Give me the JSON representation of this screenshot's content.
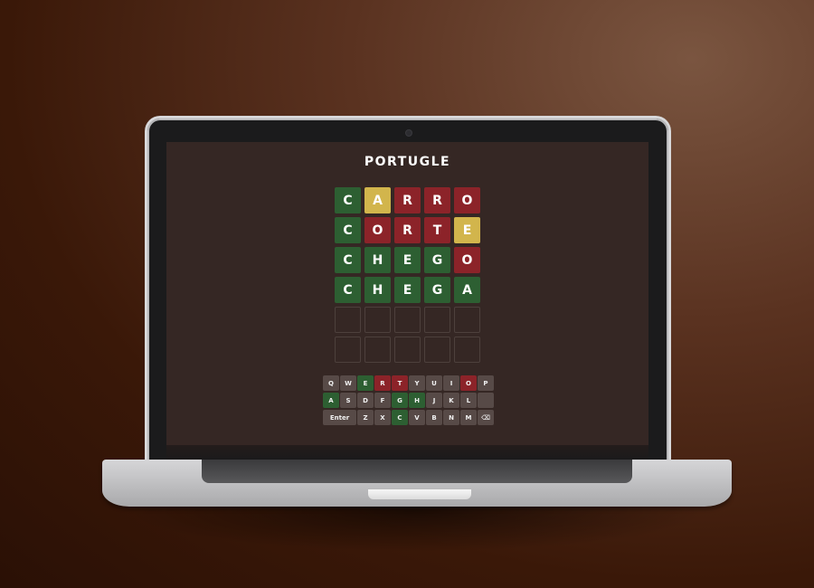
{
  "app": {
    "title": "PORTUGLE"
  },
  "board": {
    "rows": [
      [
        {
          "letter": "C",
          "state": "green"
        },
        {
          "letter": "A",
          "state": "yellow"
        },
        {
          "letter": "R",
          "state": "red"
        },
        {
          "letter": "R",
          "state": "red"
        },
        {
          "letter": "O",
          "state": "red"
        }
      ],
      [
        {
          "letter": "C",
          "state": "green"
        },
        {
          "letter": "O",
          "state": "red"
        },
        {
          "letter": "R",
          "state": "red"
        },
        {
          "letter": "T",
          "state": "red"
        },
        {
          "letter": "E",
          "state": "yellow"
        }
      ],
      [
        {
          "letter": "C",
          "state": "green"
        },
        {
          "letter": "H",
          "state": "green"
        },
        {
          "letter": "E",
          "state": "green"
        },
        {
          "letter": "G",
          "state": "green"
        },
        {
          "letter": "O",
          "state": "red"
        }
      ],
      [
        {
          "letter": "C",
          "state": "green"
        },
        {
          "letter": "H",
          "state": "green"
        },
        {
          "letter": "E",
          "state": "green"
        },
        {
          "letter": "G",
          "state": "green"
        },
        {
          "letter": "A",
          "state": "green"
        }
      ],
      [
        {
          "letter": "",
          "state": "empty"
        },
        {
          "letter": "",
          "state": "empty"
        },
        {
          "letter": "",
          "state": "empty"
        },
        {
          "letter": "",
          "state": "empty"
        },
        {
          "letter": "",
          "state": "empty"
        }
      ],
      [
        {
          "letter": "",
          "state": "empty"
        },
        {
          "letter": "",
          "state": "empty"
        },
        {
          "letter": "",
          "state": "empty"
        },
        {
          "letter": "",
          "state": "empty"
        },
        {
          "letter": "",
          "state": "empty"
        }
      ]
    ]
  },
  "keyboard": {
    "rows": [
      [
        {
          "label": "Q",
          "state": "default"
        },
        {
          "label": "W",
          "state": "default"
        },
        {
          "label": "E",
          "state": "green"
        },
        {
          "label": "R",
          "state": "red"
        },
        {
          "label": "T",
          "state": "red"
        },
        {
          "label": "Y",
          "state": "default"
        },
        {
          "label": "U",
          "state": "default"
        },
        {
          "label": "I",
          "state": "default"
        },
        {
          "label": "O",
          "state": "red"
        },
        {
          "label": "P",
          "state": "default"
        }
      ],
      [
        {
          "label": "A",
          "state": "green"
        },
        {
          "label": "S",
          "state": "default"
        },
        {
          "label": "D",
          "state": "default"
        },
        {
          "label": "F",
          "state": "default"
        },
        {
          "label": "G",
          "state": "green"
        },
        {
          "label": "H",
          "state": "green"
        },
        {
          "label": "J",
          "state": "default"
        },
        {
          "label": "K",
          "state": "default"
        },
        {
          "label": "L",
          "state": "default"
        },
        {
          "label": "",
          "state": "default"
        }
      ],
      [
        {
          "label": "Enter",
          "state": "default",
          "wide": true
        },
        {
          "label": "Z",
          "state": "default"
        },
        {
          "label": "X",
          "state": "default"
        },
        {
          "label": "C",
          "state": "green"
        },
        {
          "label": "V",
          "state": "default"
        },
        {
          "label": "B",
          "state": "default"
        },
        {
          "label": "N",
          "state": "default"
        },
        {
          "label": "M",
          "state": "default"
        },
        {
          "label": "⌫",
          "state": "default",
          "icon": "backspace-icon"
        }
      ]
    ]
  },
  "colors": {
    "green": "#2d5f32",
    "red": "#8c2329",
    "yellow": "#d2b54c",
    "key": "#574a47",
    "screen_bg": "#352724"
  }
}
